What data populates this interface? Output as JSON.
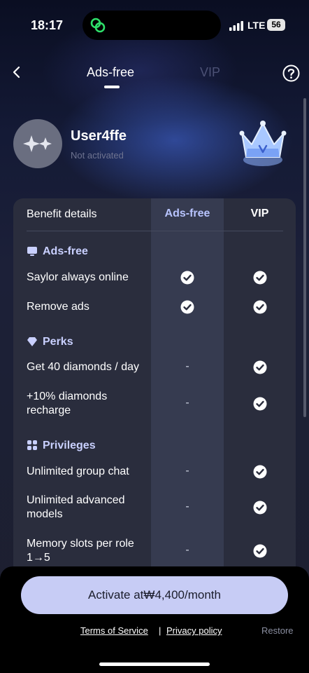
{
  "status_bar": {
    "time": "18:17",
    "network": "LTE",
    "battery": "56"
  },
  "nav": {
    "tabs": [
      {
        "label": "Ads-free",
        "active": true
      },
      {
        "label": "VIP",
        "active": false
      }
    ]
  },
  "profile": {
    "username": "User4ffe",
    "status": "Not activated"
  },
  "benefits": {
    "header": {
      "label": "Benefit details",
      "col_ads": "Ads-free",
      "col_vip": "VIP"
    },
    "sections": [
      {
        "title": "Ads-free",
        "icon": "monitor-icon",
        "rows": [
          {
            "label": "Saylor always online",
            "ads": "check",
            "vip": "check"
          },
          {
            "label": "Remove ads",
            "ads": "check",
            "vip": "check"
          }
        ]
      },
      {
        "title": "Perks",
        "icon": "diamond-icon",
        "rows": [
          {
            "label": "Get 40 diamonds / day",
            "ads": "-",
            "vip": "check"
          },
          {
            "label": "+10% diamonds recharge",
            "ads": "-",
            "vip": "check"
          }
        ]
      },
      {
        "title": "Privileges",
        "icon": "grid-icon",
        "rows": [
          {
            "label": "Unlimited group chat",
            "ads": "-",
            "vip": "check"
          },
          {
            "label": "Unlimited advanced models",
            "ads": "-",
            "vip": "check"
          },
          {
            "label": "Memory slots per role 1→5",
            "ads": "-",
            "vip": "check"
          }
        ]
      }
    ]
  },
  "footer": {
    "cta": "Activate at₩4,400/month",
    "terms": "Terms of Service",
    "separator": "|",
    "privacy": "Privacy policy",
    "restore": "Restore"
  },
  "colors": {
    "accent": "#b8c4ff",
    "cta_bg": "#c7ccf5",
    "card_bg": "#2a2d3d"
  }
}
